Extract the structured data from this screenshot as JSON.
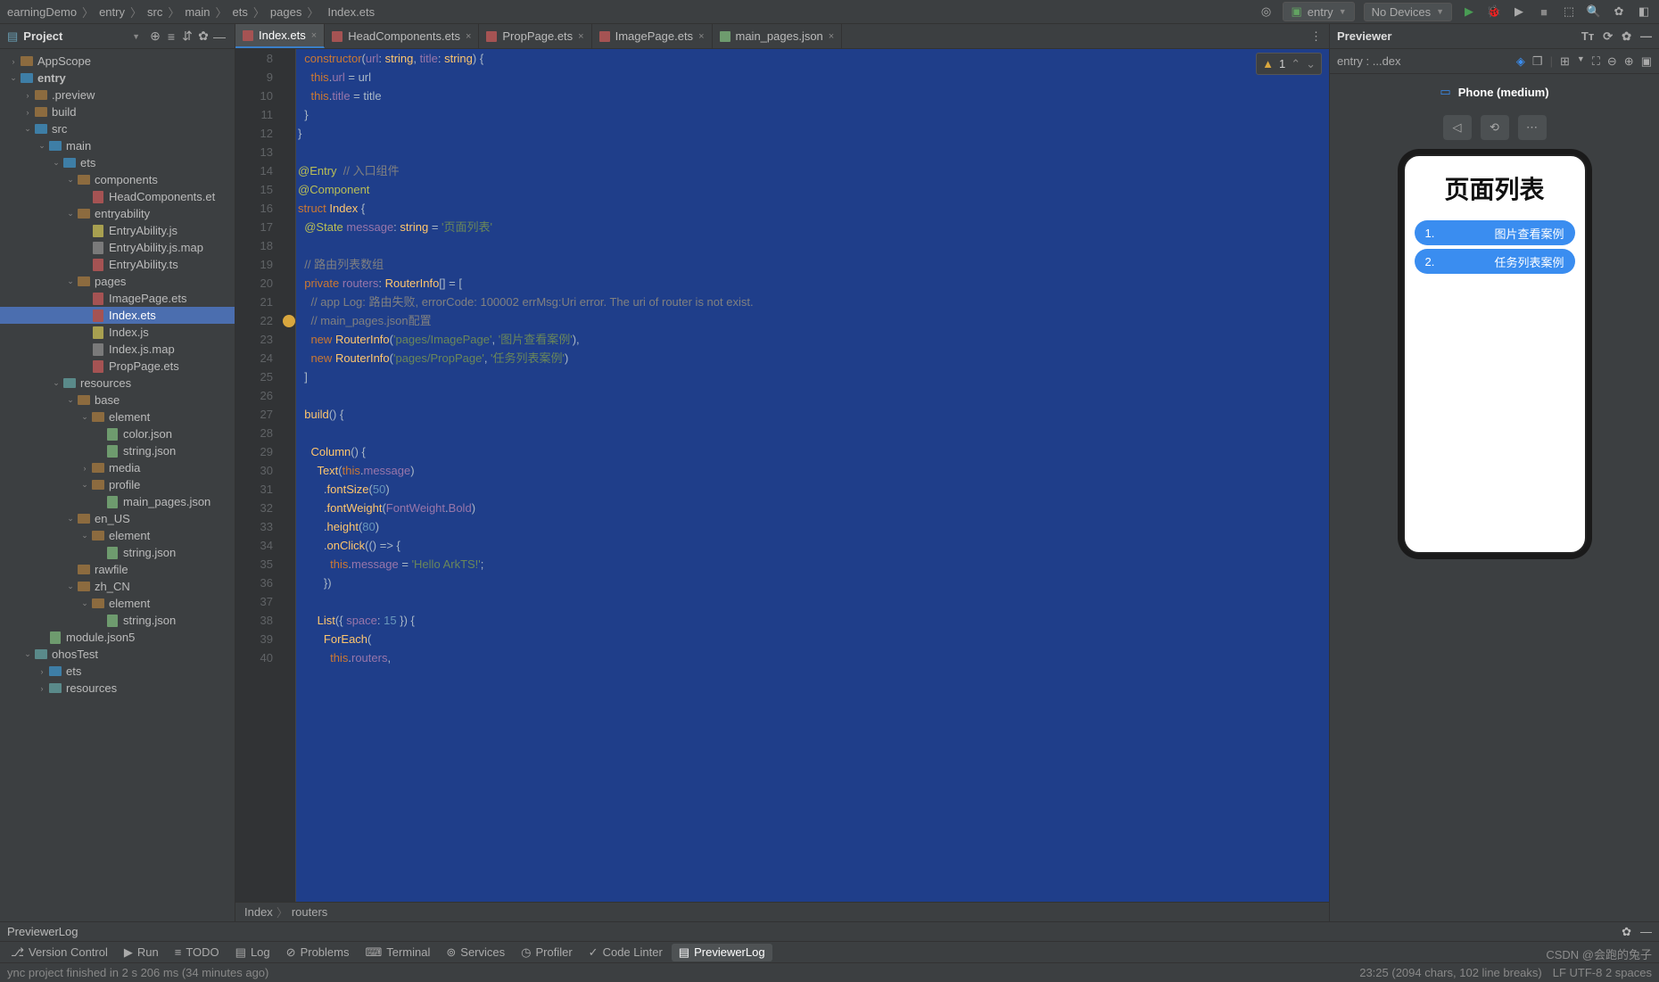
{
  "nav": {
    "breadcrumb": [
      "earningDemo",
      "entry",
      "src",
      "main",
      "ets",
      "pages",
      "Index.ets"
    ],
    "runConfig": "entry",
    "device": "No Devices"
  },
  "project": {
    "title": "Project",
    "tree": [
      {
        "d": 0,
        "tw": ">",
        "ic": "folder",
        "name": "AppScope"
      },
      {
        "d": 0,
        "tw": "v",
        "ic": "folder blue",
        "name": "entry",
        "bold": true
      },
      {
        "d": 1,
        "tw": ">",
        "ic": "folder",
        "name": ".preview"
      },
      {
        "d": 1,
        "tw": ">",
        "ic": "folder",
        "name": "build"
      },
      {
        "d": 1,
        "tw": "v",
        "ic": "folder blue",
        "name": "src"
      },
      {
        "d": 2,
        "tw": "v",
        "ic": "folder blue",
        "name": "main"
      },
      {
        "d": 3,
        "tw": "v",
        "ic": "folder blue",
        "name": "ets"
      },
      {
        "d": 4,
        "tw": "v",
        "ic": "folder",
        "name": "components"
      },
      {
        "d": 5,
        "tw": "",
        "ic": "fileic ets",
        "name": "HeadComponents.et"
      },
      {
        "d": 4,
        "tw": "v",
        "ic": "folder",
        "name": "entryability"
      },
      {
        "d": 5,
        "tw": "",
        "ic": "fileic js",
        "name": "EntryAbility.js"
      },
      {
        "d": 5,
        "tw": "",
        "ic": "fileic map",
        "name": "EntryAbility.js.map"
      },
      {
        "d": 5,
        "tw": "",
        "ic": "fileic ets",
        "name": "EntryAbility.ts"
      },
      {
        "d": 4,
        "tw": "v",
        "ic": "folder",
        "name": "pages"
      },
      {
        "d": 5,
        "tw": "",
        "ic": "fileic ets",
        "name": "ImagePage.ets"
      },
      {
        "d": 5,
        "tw": "",
        "ic": "fileic ets",
        "name": "Index.ets",
        "sel": true
      },
      {
        "d": 5,
        "tw": "",
        "ic": "fileic js",
        "name": "Index.js"
      },
      {
        "d": 5,
        "tw": "",
        "ic": "fileic map",
        "name": "Index.js.map"
      },
      {
        "d": 5,
        "tw": "",
        "ic": "fileic ets",
        "name": "PropPage.ets"
      },
      {
        "d": 3,
        "tw": "v",
        "ic": "folder teal",
        "name": "resources"
      },
      {
        "d": 4,
        "tw": "v",
        "ic": "folder",
        "name": "base"
      },
      {
        "d": 5,
        "tw": "v",
        "ic": "folder",
        "name": "element"
      },
      {
        "d": 6,
        "tw": "",
        "ic": "fileic json",
        "name": "color.json"
      },
      {
        "d": 6,
        "tw": "",
        "ic": "fileic json",
        "name": "string.json"
      },
      {
        "d": 5,
        "tw": ">",
        "ic": "folder",
        "name": "media"
      },
      {
        "d": 5,
        "tw": "v",
        "ic": "folder",
        "name": "profile"
      },
      {
        "d": 6,
        "tw": "",
        "ic": "fileic json",
        "name": "main_pages.json"
      },
      {
        "d": 4,
        "tw": "v",
        "ic": "folder",
        "name": "en_US"
      },
      {
        "d": 5,
        "tw": "v",
        "ic": "folder",
        "name": "element"
      },
      {
        "d": 6,
        "tw": "",
        "ic": "fileic json",
        "name": "string.json"
      },
      {
        "d": 4,
        "tw": "",
        "ic": "folder",
        "name": "rawfile"
      },
      {
        "d": 4,
        "tw": "v",
        "ic": "folder",
        "name": "zh_CN"
      },
      {
        "d": 5,
        "tw": "v",
        "ic": "folder",
        "name": "element"
      },
      {
        "d": 6,
        "tw": "",
        "ic": "fileic json",
        "name": "string.json"
      },
      {
        "d": 2,
        "tw": "",
        "ic": "fileic json",
        "name": "module.json5"
      },
      {
        "d": 1,
        "tw": "v",
        "ic": "folder teal",
        "name": "ohosTest"
      },
      {
        "d": 2,
        "tw": ">",
        "ic": "folder blue",
        "name": "ets"
      },
      {
        "d": 2,
        "tw": ">",
        "ic": "folder teal",
        "name": "resources"
      }
    ]
  },
  "tabs": [
    {
      "name": "Index.ets",
      "active": true,
      "ic": "ets"
    },
    {
      "name": "HeadComponents.ets",
      "ic": "ets"
    },
    {
      "name": "PropPage.ets",
      "ic": "ets"
    },
    {
      "name": "ImagePage.ets",
      "ic": "ets"
    },
    {
      "name": "main_pages.json",
      "ic": "json"
    }
  ],
  "warnings": {
    "count": "1"
  },
  "code": {
    "start": 8,
    "lines": [
      {
        "html": "  <span class='k'>constructor</span>(<span class='n'>url</span>: <span class='t'>string</span>, <span class='n'>title</span>: <span class='t'>string</span>) {"
      },
      {
        "html": "    <span class='k'>this</span>.<span class='n'>url</span> = url"
      },
      {
        "html": "    <span class='k'>this</span>.<span class='n'>title</span> = title"
      },
      {
        "html": "  }"
      },
      {
        "html": "}"
      },
      {
        "html": ""
      },
      {
        "html": "<span class='d'>@Entry</span>  <span class='c'>// 入口组件</span>"
      },
      {
        "html": "<span class='d'>@Component</span>"
      },
      {
        "html": "<span class='k'>struct</span> <span class='t'>Index</span> {"
      },
      {
        "html": "  <span class='d'>@State</span> <span class='n'>message</span>: <span class='t'>string</span> = <span class='s'>'页面列表'</span>"
      },
      {
        "html": ""
      },
      {
        "html": "  <span class='c'>// 路由列表数组</span>"
      },
      {
        "html": "  <span class='k'>private</span> <span class='n'>routers</span>: <span class='t'>RouterInfo</span>[] = ["
      },
      {
        "html": "    <span class='c'>// app Log: 路由失败, errorCode: 100002 errMsg:Uri error. The uri of router is not exist.</span>"
      },
      {
        "html": "    <span class='c'>// main_pages.json配置</span>",
        "bulb": true
      },
      {
        "html": "    <span class='k'>new</span> <span class='t'>RouterInfo</span>(<span class='s'>'pages/ImagePage'</span>, <span class='s'>'图片查看案例'</span>),"
      },
      {
        "html": "    <span class='k'>new</span> <span class='t'>RouterInfo</span>(<span class='s'>'pages/PropPage'</span>, <span class='s'>'任务列表案例'</span>)"
      },
      {
        "html": "  ]"
      },
      {
        "html": ""
      },
      {
        "html": "  <span class='t'>build</span>() {"
      },
      {
        "html": ""
      },
      {
        "html": "    <span class='t'>Column</span>() {"
      },
      {
        "html": "      <span class='t'>Text</span>(<span class='k'>this</span>.<span class='n'>message</span>)"
      },
      {
        "html": "        .<span class='t'>fontSize</span>(<span class='p'>50</span>)"
      },
      {
        "html": "        .<span class='t'>fontWeight</span>(<span class='n'>FontWeight</span>.<span class='n'>Bold</span>)"
      },
      {
        "html": "        .<span class='t'>height</span>(<span class='p'>80</span>)"
      },
      {
        "html": "        .<span class='t'>onClick</span>(() => {"
      },
      {
        "html": "          <span class='k'>this</span>.<span class='n'>message</span> = <span class='s'>'Hello ArkTS!'</span>;"
      },
      {
        "html": "        })"
      },
      {
        "html": ""
      },
      {
        "html": "      <span class='t'>List</span>({ <span class='n'>space</span>: <span class='p'>15</span> }) {"
      },
      {
        "html": "        <span class='t'>ForEach</span>("
      },
      {
        "html": "          <span class='k'>this</span>.<span class='n'>routers</span>,"
      }
    ]
  },
  "breadcrumb2": [
    "Index",
    "routers"
  ],
  "previewer": {
    "title": "Previewer",
    "entry": "entry : ...dex",
    "device": "Phone (medium)",
    "pageTitle": "页面列表",
    "items": [
      {
        "num": "1.",
        "label": "图片查看案例"
      },
      {
        "num": "2.",
        "label": "任务列表案例"
      }
    ]
  },
  "log": {
    "title": "PreviewerLog"
  },
  "tools": [
    {
      "ic": "vcs",
      "label": "Version Control"
    },
    {
      "ic": "run",
      "label": "Run"
    },
    {
      "ic": "todo",
      "label": "TODO"
    },
    {
      "ic": "log",
      "label": "Log"
    },
    {
      "ic": "prob",
      "label": "Problems"
    },
    {
      "ic": "term",
      "label": "Terminal"
    },
    {
      "ic": "svc",
      "label": "Services"
    },
    {
      "ic": "prof",
      "label": "Profiler"
    },
    {
      "ic": "lint",
      "label": "Code Linter"
    },
    {
      "ic": "plog",
      "label": "PreviewerLog",
      "active": true
    }
  ],
  "status": {
    "msg": "ync project finished in 2 s 206 ms (34 minutes ago)",
    "pos": "23:25 (2094 chars, 102 line breaks)",
    "enc": "LF   UTF-8   2 spaces"
  },
  "watermark": "CSDN @会跑的兔子"
}
